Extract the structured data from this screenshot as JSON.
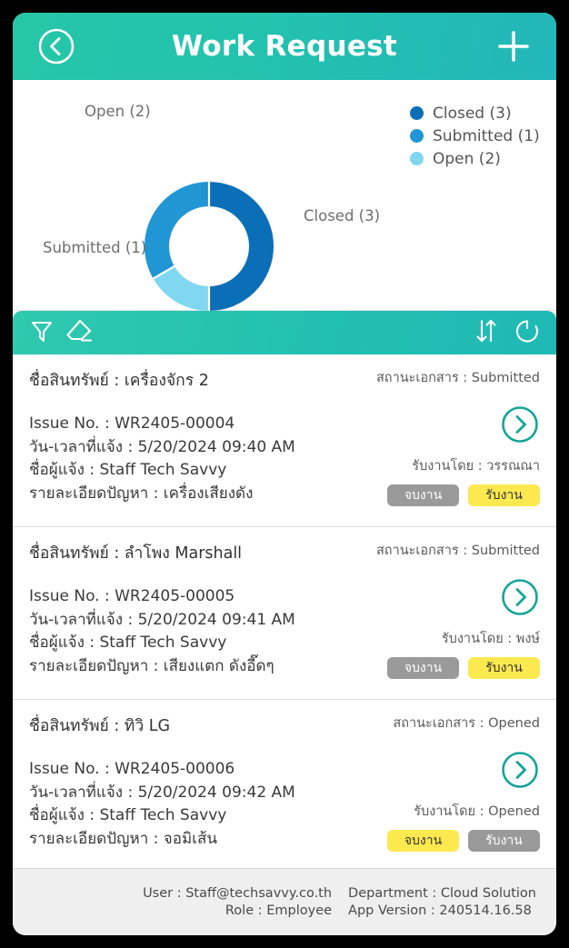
{
  "header": {
    "title": "Work Request",
    "back_icon": "chevron-left-circle-icon",
    "add_icon": "plus-icon",
    "bg_start": "#26c6a8",
    "bg_end": "#23b6ba"
  },
  "chart_data": {
    "type": "pie",
    "variant": "donut",
    "title": "",
    "categories": [
      "Closed",
      "Submitted",
      "Open"
    ],
    "values": [
      3,
      1,
      2
    ],
    "total": 6,
    "colors": [
      "#0b6fb8",
      "#7fd8f0",
      "#2196d4"
    ],
    "slice_labels": [
      "Closed (3)",
      "Submitted (1)",
      "Open (2)"
    ],
    "legend": {
      "position": "right",
      "entries": [
        {
          "label": "Closed (3)",
          "color": "#0b6fb8"
        },
        {
          "label": "Submitted (1)",
          "color": "#2196d4"
        },
        {
          "label": "Open (2)",
          "color": "#7fd8f0"
        }
      ]
    },
    "annotations": {
      "open": "Open (2)",
      "submitted": "Submitted (1)",
      "closed": "Closed (3)"
    }
  },
  "filterbar": {
    "filter_icon": "funnel-filter-icon",
    "clear_icon": "eraser-icon",
    "sort_icon": "sort-arrows-icon",
    "refresh_icon": "refresh-icon"
  },
  "list": {
    "labels": {
      "asset_prefix": "ชื่อสินทรัพย์ : ",
      "status_prefix": "สถานะเอกสาร : ",
      "issue_prefix": "Issue No. : ",
      "datetime_prefix": "วัน-เวลาที่แจ้ง : ",
      "reporter_prefix": "ชื่อผู้แจ้ง : ",
      "problem_prefix": "รายละเอียดปัญหา : ",
      "assignee_prefix": "รับงานโดย : ",
      "finish_button": "จบงาน",
      "accept_button": "รับงาน",
      "detail_icon": "chevron-right-circle-icon"
    },
    "rows": [
      {
        "asset": "ชื่อสินทรัพย์ : เครื่องจักร 2",
        "doc_status": "สถานะเอกสาร : Submitted",
        "issue_no": "Issue No. : WR2405-00004",
        "datetime": "วัน-เวลาที่แจ้ง : 5/20/2024  09:40 AM",
        "reporter": "ชื่อผู้แจ้ง : Staff Tech Savvy",
        "problem": "รายละเอียดปัญหา : เครื่องเสียงดัง",
        "assignee": "รับงานโดย : วรรณณา",
        "finish_label": "จบงาน",
        "accept_label": "รับงาน",
        "finish_style": "grey",
        "accept_style": "yellow"
      },
      {
        "asset": "ชื่อสินทรัพย์ : ลำโพง Marshall",
        "doc_status": "สถานะเอกสาร : Submitted",
        "issue_no": "Issue No. : WR2405-00005",
        "datetime": "วัน-เวลาที่แจ้ง : 5/20/2024  09:41 AM",
        "reporter": "ชื่อผู้แจ้ง : Staff Tech Savvy",
        "problem": "รายละเอียดปัญหา : เสียงแตก ดังอี๊ดๆ",
        "assignee": "รับงานโดย : พงษ์",
        "finish_label": "จบงาน",
        "accept_label": "รับงาน",
        "finish_style": "grey",
        "accept_style": "yellow"
      },
      {
        "asset": "ชื่อสินทรัพย์ : ทิวิ LG",
        "doc_status": "สถานะเอกสาร : Opened",
        "issue_no": "Issue No. : WR2405-00006",
        "datetime": "วัน-เวลาที่แจ้ง : 5/20/2024  09:42 AM",
        "reporter": "ชื่อผู้แจ้ง : Staff Tech Savvy",
        "problem": "รายละเอียดปัญหา : จอมิเส้น",
        "assignee": "รับงานโดย : Opened",
        "finish_label": "จบงาน",
        "accept_label": "รับงาน",
        "finish_style": "yellow",
        "accept_style": "grey"
      }
    ]
  },
  "footer": {
    "user": "User : Staff@techsavvy.co.th",
    "department": "Department : Cloud Solution",
    "role": "Role : Employee",
    "app_version": "App Version : 240514.16.58"
  }
}
